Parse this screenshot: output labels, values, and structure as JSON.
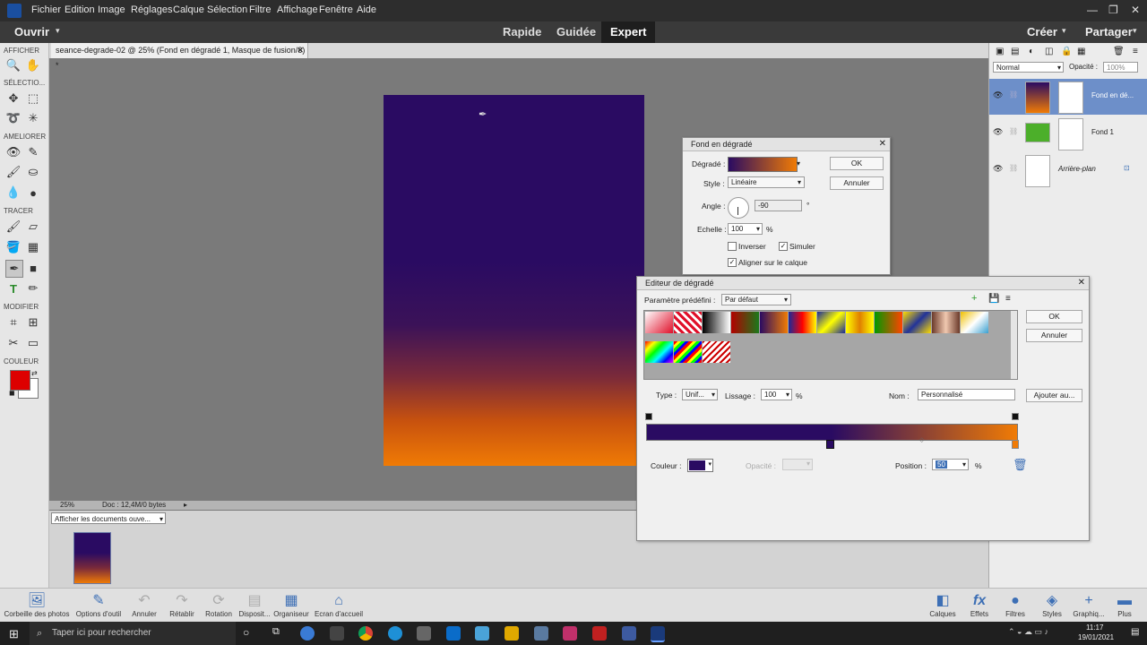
{
  "menubar": {
    "items": [
      "Fichier",
      "Edition",
      "Image",
      "Réglages",
      "Calque",
      "Sélection",
      "Filtre",
      "Affichage",
      "Fenêtre",
      "Aide"
    ]
  },
  "modebar": {
    "open_label": "Ouvrir",
    "modes": [
      "Rapide",
      "Guidée",
      "Expert"
    ],
    "active_mode": "Expert",
    "create_label": "Créer",
    "share_label": "Partager"
  },
  "tools": {
    "sections": [
      "AFFICHER",
      "SÉLECTIO...",
      "AMELIORER",
      "TRACER",
      "MODIFIER",
      "COULEUR"
    ],
    "foreground_color": "#dd0000",
    "background_color": "#ffffff"
  },
  "document": {
    "tab_title": "seance-degrade-02 @ 25% (Fond en dégradé 1, Masque de fusion/8) *",
    "zoom": "25%",
    "doc_info": "Doc : 12,4M/0 bytes",
    "gradient_top": "#2a0b62",
    "gradient_bottom": "#f07b05"
  },
  "bin": {
    "select_label": "Afficher les documents ouve..."
  },
  "layers_panel": {
    "blend_mode": "Normal",
    "opacity_label": "Opacité :",
    "opacity_value": "100%",
    "layers": [
      {
        "name": "Fond en dé...",
        "selected": true
      },
      {
        "name": "Fond 1",
        "selected": false
      },
      {
        "name": "Arrière-plan",
        "selected": false
      }
    ]
  },
  "fill_dialog": {
    "title": "Fond en dégradé",
    "gradient_label": "Dégradé :",
    "style_label": "Style :",
    "style_value": "Linéaire",
    "angle_label": "Angle :",
    "angle_value": "-90",
    "degree_sign": "°",
    "scale_label": "Echelle :",
    "scale_value": "100",
    "percent": "%",
    "inverse_label": "Inverser",
    "simulate_label": "Simuler",
    "align_label": "Aligner sur le calque",
    "inverse_checked": false,
    "simulate_checked": true,
    "align_checked": true,
    "ok_label": "OK",
    "cancel_label": "Annuler"
  },
  "gradient_editor": {
    "title": "Editeur de dégradé",
    "preset_label": "Paramètre prédéfini :",
    "preset_value": "Par défaut",
    "ok_label": "OK",
    "cancel_label": "Annuler",
    "type_label": "Type :",
    "type_value": "Unif...",
    "smooth_label": "Lissage :",
    "smooth_value": "100",
    "percent": "%",
    "name_label": "Nom :",
    "name_value": "Personnalisé",
    "add_label": "Ajouter au...",
    "color_label": "Couleur :",
    "opacity_label": "Opacité :",
    "position_label": "Position :",
    "position_value": "50",
    "stop_color": "#2a0b62",
    "end_color": "#f07b05",
    "presets": [
      "linear-gradient(135deg,#fff,#e0102a)",
      "repeating-linear-gradient(45deg,#e0102a 0 3px,#fff 3px 6px)",
      "linear-gradient(90deg,#000,#fff)",
      "linear-gradient(90deg,#b30000,#1a7a1a)",
      "linear-gradient(90deg,#2a0b62,#f07b05)",
      "linear-gradient(90deg,#1a2a99,#f00,#ff0)",
      "linear-gradient(135deg,#1a2a99,#ff0,#1a2a99)",
      "linear-gradient(90deg,#ff0,#e08000,#ff0)",
      "linear-gradient(90deg,#009900,#ff4400)",
      "linear-gradient(135deg,#ffdd00,#223399,#ffdd00)",
      "linear-gradient(90deg,#6b3a2a,#f0c8b0,#6b3a2a)",
      "linear-gradient(135deg,#f0c000,#fff,#3aa0d0)",
      "linear-gradient(135deg,#f00,#ff0,#0f0,#0ff,#00f,#f0f)",
      "repeating-linear-gradient(135deg,#f00 0 3px,#ff0 3px 6px,#0f0 6px 9px,#00f 9px 12px)",
      "repeating-linear-gradient(135deg,#c00 0 2px,#fff 2px 5px)"
    ]
  },
  "pse_taskbar": {
    "left_buttons": [
      "Corbeille des photos",
      "Options d'outil",
      "Annuler",
      "Rétablir",
      "Rotation",
      "Disposit...",
      "Organiseur",
      "Ecran d'accueil"
    ],
    "right_buttons": [
      "Calques",
      "Effets",
      "Filtres",
      "Styles",
      "Graphiq...",
      "Plus"
    ]
  },
  "windows_taskbar": {
    "search_placeholder": "Taper ici pour rechercher",
    "time": "11:17",
    "date": "19/01/2021"
  }
}
